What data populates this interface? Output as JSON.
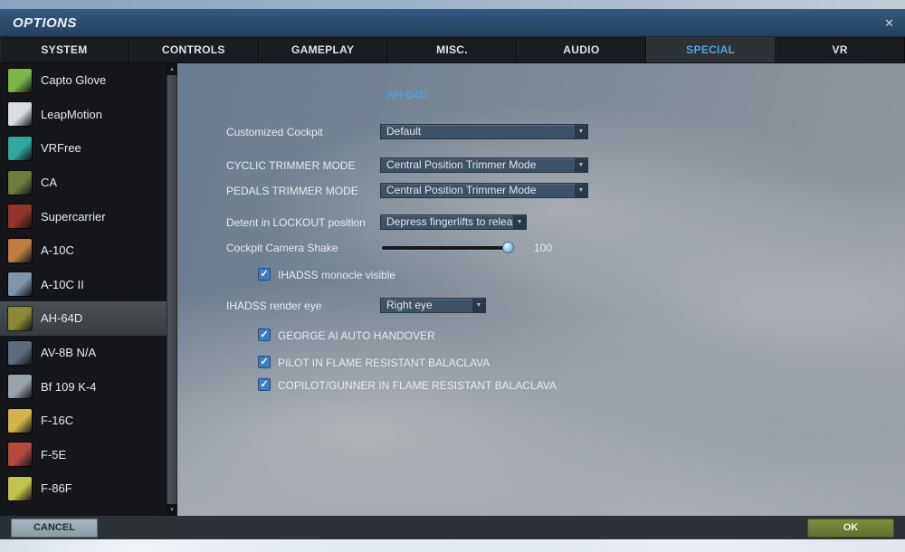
{
  "window": {
    "title": "OPTIONS"
  },
  "icons": {
    "close": "✕",
    "dropdown_arrow": "▼",
    "check": "✓",
    "scroll_up": "▲",
    "scroll_down": "▼"
  },
  "colors": {
    "accent": "#4ca6e8",
    "checkbox": "#3d7ec2",
    "ok_button": "#6e7d33",
    "cancel_button": "#93a2ac",
    "titlebar": "#2c4e77"
  },
  "tabs": [
    {
      "label": "SYSTEM"
    },
    {
      "label": "CONTROLS"
    },
    {
      "label": "GAMEPLAY"
    },
    {
      "label": "MISC."
    },
    {
      "label": "AUDIO"
    },
    {
      "label": "SPECIAL",
      "active": true
    },
    {
      "label": "VR"
    }
  ],
  "sidebar": {
    "items": [
      {
        "label": "Capto Glove",
        "icon": "capto-glove-icon",
        "icon_color": "#7ab648"
      },
      {
        "label": "LeapMotion",
        "icon": "leapmotion-icon",
        "icon_color": "#d9dde0"
      },
      {
        "label": "VRFree",
        "icon": "vrfree-icon",
        "icon_color": "#2fa8a0"
      },
      {
        "label": "CA",
        "icon": "ca-icon",
        "icon_color": "#6f7d3c"
      },
      {
        "label": "Supercarrier",
        "icon": "supercarrier-icon",
        "icon_color": "#93342c"
      },
      {
        "label": "A-10C",
        "icon": "a-10c-icon",
        "icon_color": "#c07c3e"
      },
      {
        "label": "A-10C II",
        "icon": "a-10c-ii-icon",
        "icon_color": "#7e95aa"
      },
      {
        "label": "AH-64D",
        "icon": "ah-64d-icon",
        "icon_color": "#8a8a34",
        "selected": true
      },
      {
        "label": "AV-8B N/A",
        "icon": "av-8b-icon",
        "icon_color": "#5c6c7c"
      },
      {
        "label": "Bf 109 K-4",
        "icon": "bf-109-icon",
        "icon_color": "#9aa2aa"
      },
      {
        "label": "F-16C",
        "icon": "f-16c-icon",
        "icon_color": "#d2b44a"
      },
      {
        "label": "F-5E",
        "icon": "f-5e-icon",
        "icon_color": "#b44a3c"
      },
      {
        "label": "F-86F",
        "icon": "f-86f-icon",
        "icon_color": "#c2c24e"
      }
    ]
  },
  "panel": {
    "title": "AH-64D",
    "customized_cockpit": {
      "label": "Customized Cockpit",
      "value": "Default"
    },
    "cyclic_trimmer": {
      "label": "CYCLIC TRIMMER MODE",
      "value": "Central Position Trimmer Mode"
    },
    "pedals_trimmer": {
      "label": "PEDALS TRIMMER MODE",
      "value": "Central Position Trimmer Mode"
    },
    "detent_lockout": {
      "label": "Detent in LOCKOUT position",
      "value": "Depress fingerlifts to release l"
    },
    "camera_shake": {
      "label": "Cockpit Camera Shake",
      "value": 100
    },
    "ihadss_monocle": {
      "label": "IHADSS monocle visible",
      "checked": true
    },
    "ihadss_render_eye": {
      "label": "IHADSS render eye",
      "value": "Right eye"
    },
    "george_ai": {
      "label": "GEORGE AI AUTO HANDOVER",
      "checked": true
    },
    "pilot_balaclava": {
      "label": "PILOT IN FLAME RESISTANT BALACLAVA",
      "checked": true
    },
    "copilot_balaclava": {
      "label": "COPILOT/GUNNER IN FLAME RESISTANT BALACLAVA",
      "checked": true
    }
  },
  "footer": {
    "cancel_label": "CANCEL",
    "ok_label": "OK"
  }
}
